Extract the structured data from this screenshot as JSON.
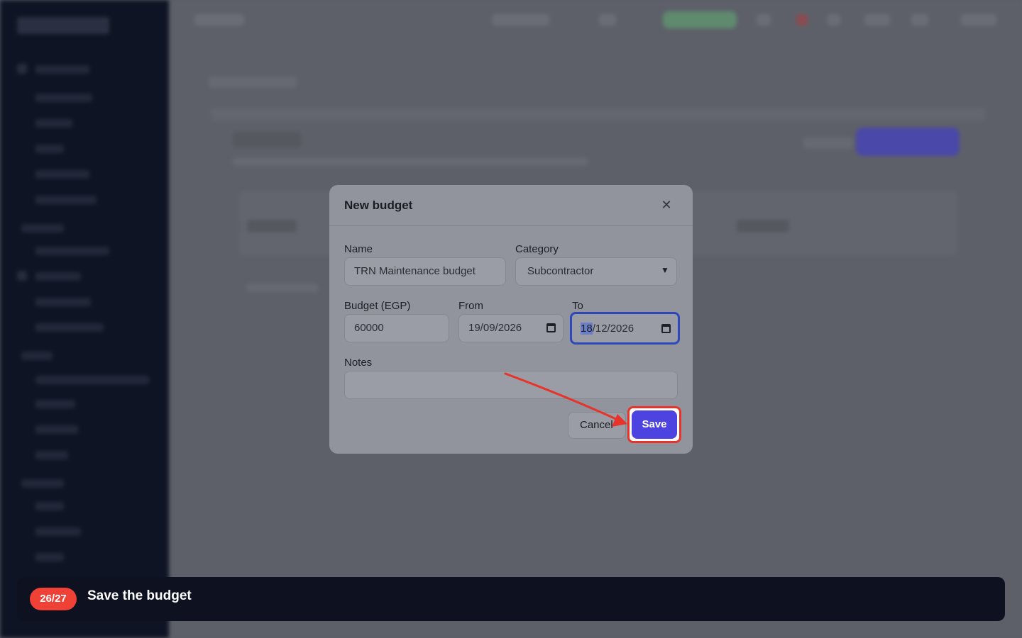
{
  "modal": {
    "title": "New budget",
    "close_icon": "close-icon",
    "name_label": "Name",
    "name_value": "TRN Maintenance budget",
    "category_label": "Category",
    "category_value": "Subcontractor",
    "budget_label": "Budget (EGP)",
    "budget_value": "60000",
    "from_label": "From",
    "from_value": "19/09/2026",
    "to_label": "To",
    "to_value_selected": "18",
    "to_value_rest": "/12/2026",
    "notes_label": "Notes",
    "notes_value": "",
    "cancel_label": "Cancel",
    "save_label": "Save"
  },
  "tour": {
    "step": "26/27",
    "instruction": "Save the budget"
  },
  "colors": {
    "accent": "#4c43e0",
    "highlight": "#e8332a",
    "badge": "#ef4136"
  }
}
